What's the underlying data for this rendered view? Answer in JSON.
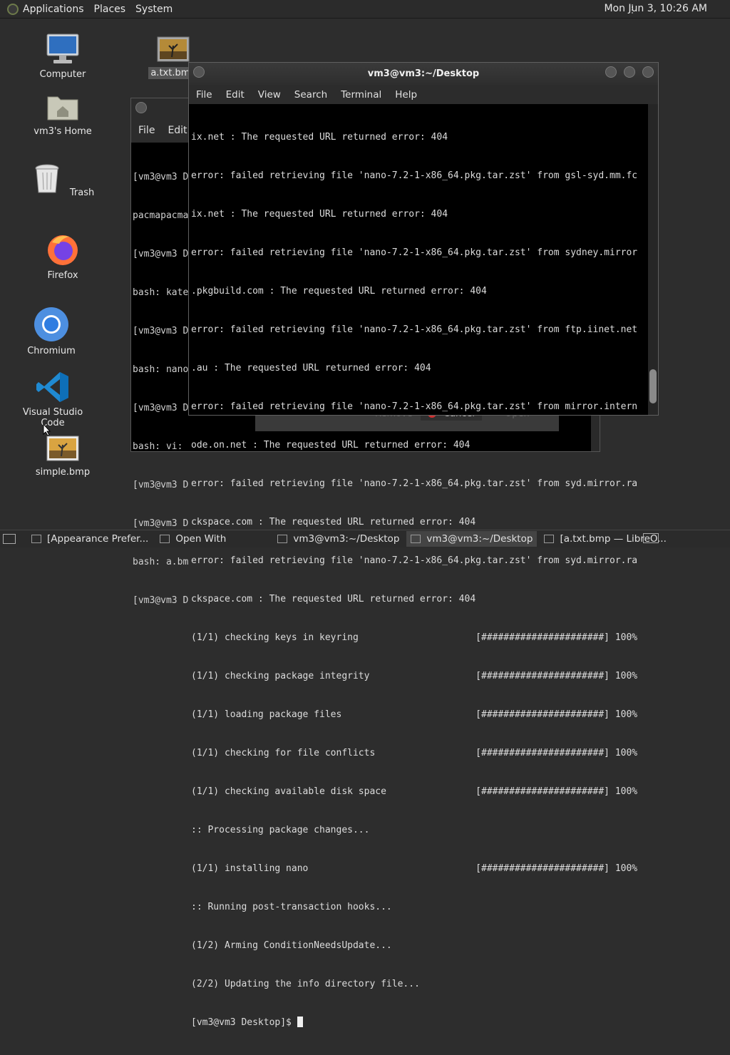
{
  "topbar": {
    "menus": [
      "Applications",
      "Places",
      "System"
    ],
    "clock": "Mon Jun  3, 10:26 AM"
  },
  "desktop_icons": [
    {
      "label": "Computer",
      "icon": "computer-icon"
    },
    {
      "label": "vm3's Home",
      "icon": "home-folder-icon"
    },
    {
      "label": "Trash",
      "icon": "trash-icon"
    },
    {
      "label": "Firefox",
      "icon": "firefox-icon"
    },
    {
      "label": "Chromium",
      "icon": "chromium-icon"
    },
    {
      "label": "Visual Studio Code",
      "icon": "vscode-icon"
    },
    {
      "label": "simple.bmp",
      "icon": "image-file-icon"
    },
    {
      "label": "a.txt.bmp",
      "icon": "image-file-icon"
    }
  ],
  "bg_window": {
    "menus": [
      "File",
      "Edit"
    ],
    "lines": [
      "[vm3@vm3 D",
      "pacmapacma",
      "[vm3@vm3 D",
      "bash: kate",
      "[vm3@vm3 D",
      "bash: nano",
      "[vm3@vm3 D",
      "bash: vi: ",
      "[vm3@vm3 D",
      "[vm3@vm3 D",
      "bash: a.bm",
      "[vm3@vm3 D"
    ]
  },
  "dialog_fragment": {
    "buttons": [
      "Remove",
      "Cancel",
      "Open"
    ]
  },
  "terminal": {
    "title": "vm3@vm3:~/Desktop",
    "menus": [
      "File",
      "Edit",
      "View",
      "Search",
      "Terminal",
      "Help"
    ],
    "lines": [
      "ix.net : The requested URL returned error: 404",
      "error: failed retrieving file 'nano-7.2-1-x86_64.pkg.tar.zst' from gsl-syd.mm.fc",
      "ix.net : The requested URL returned error: 404",
      "error: failed retrieving file 'nano-7.2-1-x86_64.pkg.tar.zst' from sydney.mirror",
      ".pkgbuild.com : The requested URL returned error: 404",
      "error: failed retrieving file 'nano-7.2-1-x86_64.pkg.tar.zst' from ftp.iinet.net",
      ".au : The requested URL returned error: 404",
      "error: failed retrieving file 'nano-7.2-1-x86_64.pkg.tar.zst' from mirror.intern",
      "ode.on.net : The requested URL returned error: 404",
      "error: failed retrieving file 'nano-7.2-1-x86_64.pkg.tar.zst' from syd.mirror.ra",
      "ckspace.com : The requested URL returned error: 404",
      "error: failed retrieving file 'nano-7.2-1-x86_64.pkg.tar.zst' from syd.mirror.ra",
      "ckspace.com : The requested URL returned error: 404",
      "(1/1) checking keys in keyring                     [######################] 100%",
      "(1/1) checking package integrity                   [######################] 100%",
      "(1/1) loading package files                        [######################] 100%",
      "(1/1) checking for file conflicts                  [######################] 100%",
      "(1/1) checking available disk space                [######################] 100%",
      ":: Processing package changes...",
      "(1/1) installing nano                              [######################] 100%",
      ":: Running post-transaction hooks...",
      "(1/2) Arming ConditionNeedsUpdate...",
      "(2/2) Updating the info directory file..."
    ],
    "prompt": "[vm3@vm3 Desktop]$ "
  },
  "taskbar": {
    "items": [
      {
        "label": "[Appearance Prefer...",
        "active": false
      },
      {
        "label": "Open With",
        "active": false
      },
      {
        "label": "vm3@vm3:~/Desktop",
        "active": false
      },
      {
        "label": "vm3@vm3:~/Desktop",
        "active": true
      },
      {
        "label": "[a.txt.bmp — LibreO...",
        "active": false
      }
    ]
  }
}
